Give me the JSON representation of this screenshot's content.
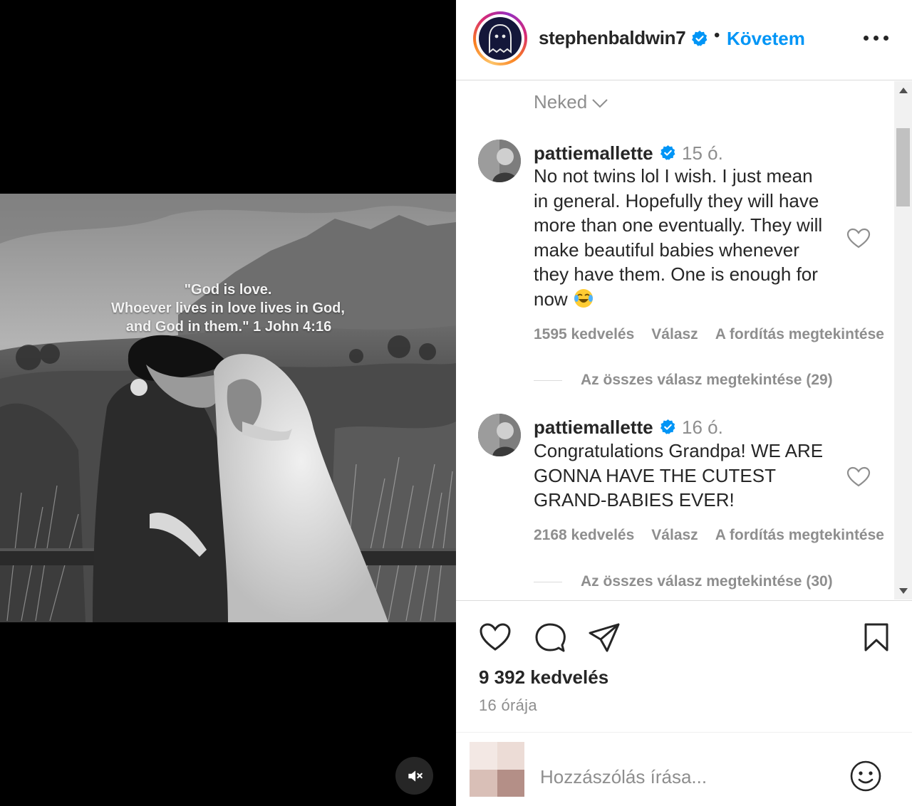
{
  "media": {
    "quote_lines": [
      "\"God is love.",
      "Whoever lives in love lives in God,",
      "and God in them.\" 1 John 4:16"
    ]
  },
  "header": {
    "username": "stephenbaldwin7",
    "dot": "•",
    "follow_label": "Követem",
    "avatar_icon": "ghost-icon"
  },
  "comments": {
    "sort_label": "Neked",
    "items": [
      {
        "user": "pattiemallette",
        "time": "15 ó.",
        "lines": [
          "No not twins lol I wish. I just mean",
          "in general. Hopefully they will have",
          "more than one eventually. They will",
          "make beautiful babies whenever",
          "they have them. One is enough for",
          "now"
        ],
        "emoji": "tears-of-joy-emoji",
        "likes": "1595 kedvelés",
        "reply": "Válasz",
        "translate": "A fordítás megtekintése",
        "replies": "Az összes válasz megtekintése (29)"
      },
      {
        "user": "pattiemallette",
        "time": "16 ó.",
        "lines": [
          "Congratulations Grandpa! WE ARE",
          "GONNA HAVE THE CUTEST",
          "GRAND-BABIES EVER!"
        ],
        "likes": "2168 kedvelés",
        "reply": "Válasz",
        "translate": "A fordítás megtekintése",
        "replies": "Az összes válasz megtekintése (30)"
      }
    ]
  },
  "actions": {
    "likes": "9 392 kedvelés",
    "posted": "16 órája"
  },
  "add_comment": {
    "placeholder": "Hozzászólás írása..."
  },
  "colors": {
    "link": "#0095f6",
    "verified": "#0095f6",
    "muted": "#8e8e8e"
  }
}
